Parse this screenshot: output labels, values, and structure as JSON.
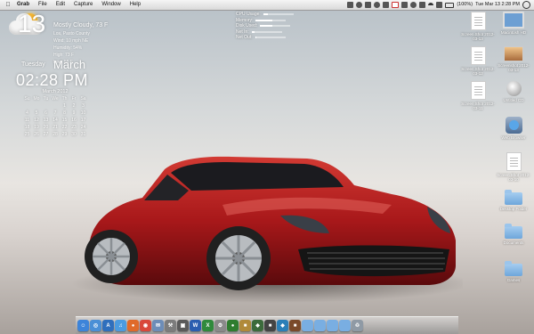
{
  "menubar": {
    "apple_glyph": "",
    "items": [
      "Grab",
      "File",
      "Edit",
      "Capture",
      "Window",
      "Help"
    ],
    "status": {
      "battery_text": "(100%)",
      "clock": "Tue Mar 13  2:28 PM"
    }
  },
  "weather": {
    "icon": "partly-cloudy-icon",
    "condition": "Mostly Cloudy, 73 F",
    "location": "Los, Pasto County",
    "wind": "Wind: 10 mph NE",
    "humidity": "Humidity: 54%",
    "high": "High: 73 F",
    "low": "Low: 55 F"
  },
  "date": {
    "day_number": "13",
    "weekday": "Tuesday",
    "month": "March",
    "time": "02:28 PM"
  },
  "calendar": {
    "title": "March 2012",
    "headers": [
      "Su",
      "Mo",
      "Tu",
      "We",
      "Th",
      "Fr",
      "Sa"
    ],
    "rows": [
      [
        "",
        "",
        "",
        "",
        "1",
        "2",
        "3"
      ],
      [
        "4",
        "5",
        "6",
        "7",
        "8",
        "9",
        "10"
      ],
      [
        "11",
        "12",
        "13",
        "14",
        "15",
        "16",
        "17"
      ],
      [
        "18",
        "19",
        "20",
        "21",
        "22",
        "23",
        "24"
      ],
      [
        "25",
        "26",
        "27",
        "28",
        "29",
        "30",
        "31"
      ]
    ]
  },
  "sysstats": {
    "rows": [
      {
        "label": "CPU Usage:",
        "value": "",
        "level": 0.15
      },
      {
        "label": "Memory:",
        "value": "",
        "level": 0.55
      },
      {
        "label": "Disk Used:",
        "value": "",
        "level": 0.4
      },
      {
        "label": "Net In:",
        "value": "",
        "level": 0.1
      },
      {
        "label": "Net Out:",
        "value": "",
        "level": 0.05
      }
    ]
  },
  "desktop_icons": [
    {
      "name": "doc-icon-1",
      "kind": "doc",
      "label": "Screen Shot 2012-03-13"
    },
    {
      "name": "monitor-icon",
      "kind": "monitor",
      "label": "Macintosh HD"
    },
    {
      "name": "doc-icon-2",
      "kind": "doc",
      "label": "Screen Shot 2012-03-12"
    },
    {
      "name": "photo-icon",
      "kind": "photo",
      "label": "Screenshot 2012-03-13"
    },
    {
      "name": "doc-icon-3",
      "kind": "doc",
      "label": "Screen Shot 2012-03-11"
    },
    {
      "name": "disc-icon",
      "kind": "disc",
      "label": "Untitled CD"
    },
    {
      "name": "globe-app-icon",
      "kind": "globe",
      "label": "Web Browser"
    },
    {
      "name": "doc-icon-4",
      "kind": "doc",
      "label": "Screen Shot 2012-03-10"
    },
    {
      "name": "folder-icon-1",
      "kind": "folder",
      "label": "Desktop Folder"
    },
    {
      "name": "folder-icon-2",
      "kind": "folder",
      "label": "Documents"
    },
    {
      "name": "folder-icon-3",
      "kind": "folder",
      "label": "Games"
    }
  ],
  "dock": {
    "items": [
      {
        "name": "finder-icon",
        "color": "#3d84d9",
        "glyph": "☺"
      },
      {
        "name": "safari-icon",
        "color": "#4a8fd6",
        "glyph": "◎"
      },
      {
        "name": "appstore-icon",
        "color": "#2f6fbd",
        "glyph": "A"
      },
      {
        "name": "itunes-icon",
        "color": "#4b9be0",
        "glyph": "♫"
      },
      {
        "name": "firefox-icon",
        "color": "#e06a2a",
        "glyph": "●"
      },
      {
        "name": "chrome-icon",
        "color": "#d9483b",
        "glyph": "◉"
      },
      {
        "name": "mail-icon",
        "color": "#6d8db8",
        "glyph": "✉"
      },
      {
        "name": "tools-icon",
        "color": "#7c7c7c",
        "glyph": "⚒"
      },
      {
        "name": "app-icon-1",
        "color": "#5a5a5a",
        "glyph": "▣"
      },
      {
        "name": "word-icon",
        "color": "#2a5eb0",
        "glyph": "W"
      },
      {
        "name": "excel-icon",
        "color": "#2f8a3c",
        "glyph": "X"
      },
      {
        "name": "settings-icon",
        "color": "#8a8a8a",
        "glyph": "⚙"
      },
      {
        "name": "app-icon-2",
        "color": "#2f7d2f",
        "glyph": "●"
      },
      {
        "name": "app-icon-3",
        "color": "#b08a3a",
        "glyph": "■"
      },
      {
        "name": "app-icon-4",
        "color": "#3c6b3c",
        "glyph": "◆"
      },
      {
        "name": "app-icon-5",
        "color": "#444444",
        "glyph": "■"
      },
      {
        "name": "app-icon-6",
        "color": "#2a7fb8",
        "glyph": "◆"
      },
      {
        "name": "app-icon-7",
        "color": "#7a4a2a",
        "glyph": "■"
      },
      {
        "name": "folder-dock-icon-1",
        "color": "#79aee2",
        "glyph": ""
      },
      {
        "name": "folder-dock-icon-2",
        "color": "#79aee2",
        "glyph": ""
      },
      {
        "name": "folder-dock-icon-3",
        "color": "#79aee2",
        "glyph": ""
      },
      {
        "name": "folder-dock-icon-4",
        "color": "#79aee2",
        "glyph": ""
      },
      {
        "name": "trash-icon",
        "color": "#8f9aa5",
        "glyph": "♲"
      }
    ]
  }
}
